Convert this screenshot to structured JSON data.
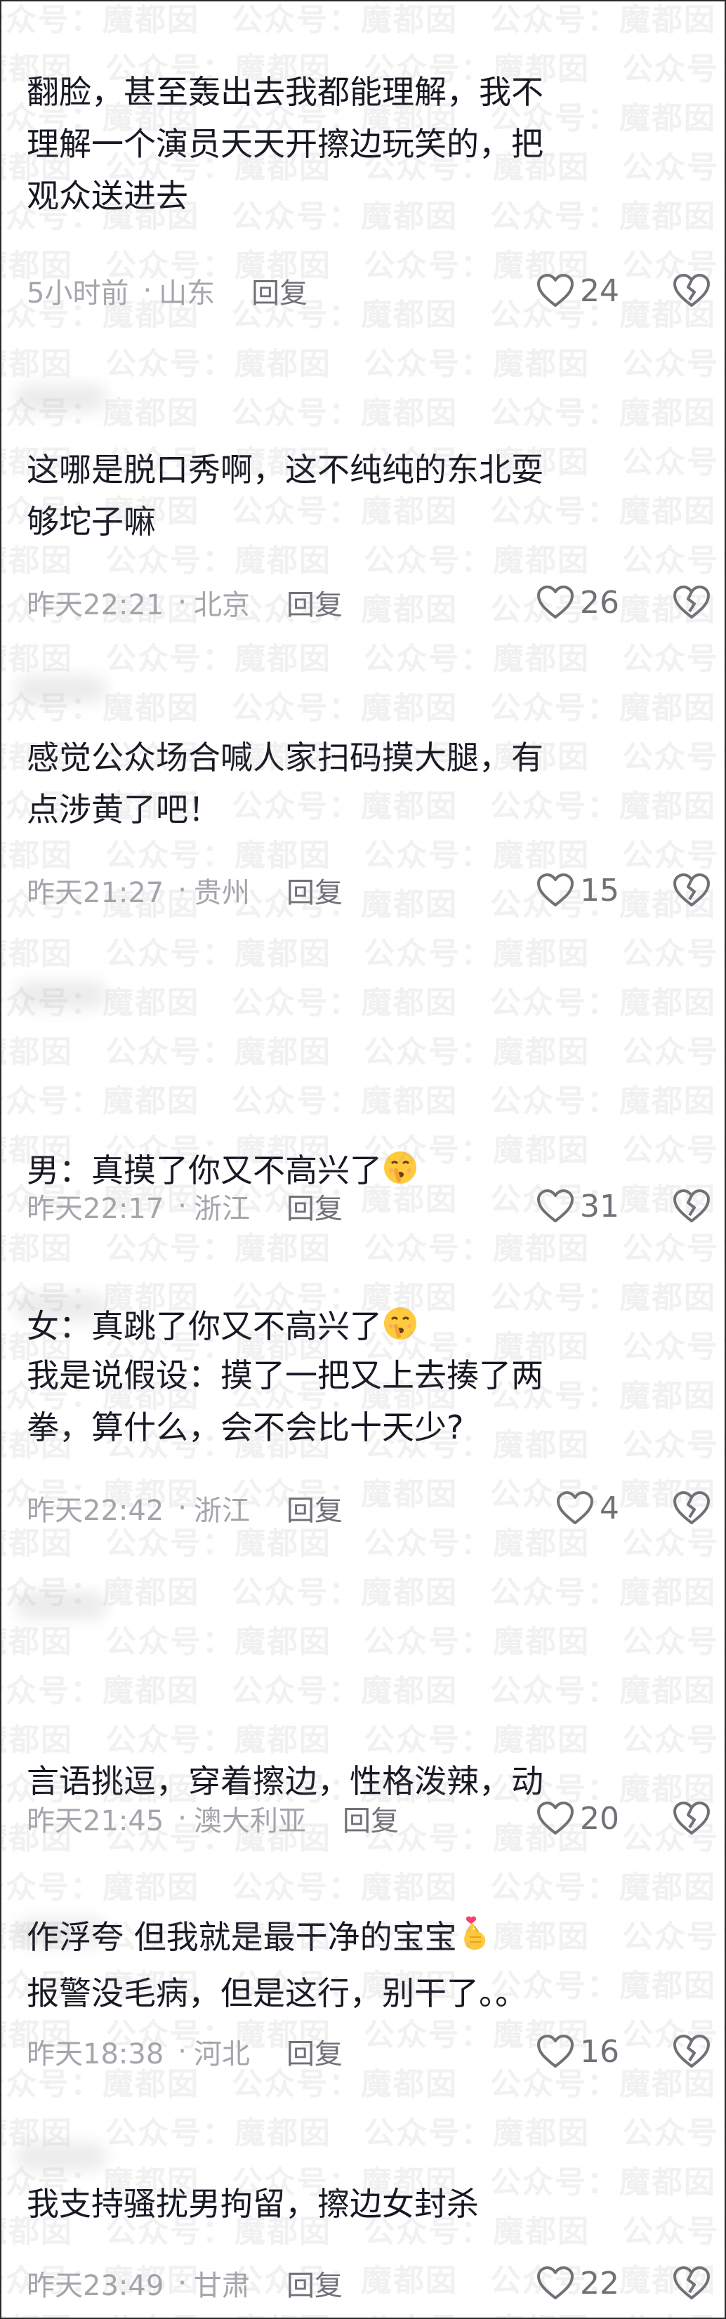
{
  "watermark": {
    "text": "公众号：魔都囡"
  },
  "comments": [
    {
      "text": "翻脸，甚至轰出去我都能理解，我不\n理解一个演员天天开擦边玩笑的，把\n观众送进去",
      "time": "5小时前",
      "location": "山东",
      "reply_label": "回复",
      "likes": "24"
    },
    {
      "text": "这哪是脱口秀啊，这不纯纯的东北耍\n够坨子嘛",
      "time": "昨天22:21",
      "location": "北京",
      "reply_label": "回复",
      "likes": "26"
    },
    {
      "text": "感觉公众场合喊人家扫码摸大腿，有\n点涉黄了吧！",
      "time": "昨天21:27",
      "location": "贵州",
      "reply_label": "回复",
      "likes": "15"
    },
    {
      "line1": "男：真摸了你又不高兴了",
      "line2": "女：真跳了你又不高兴了",
      "emoji": "shushing-face-emoji",
      "time": "昨天22:17",
      "location": "浙江",
      "reply_label": "回复",
      "likes": "31"
    },
    {
      "text": "我是说假设：摸了一把又上去揍了两\n拳，算什么，会不会比十天少?",
      "time": "昨天22:42",
      "location": "浙江",
      "reply_label": "回复",
      "likes": "4"
    },
    {
      "line1": "言语挑逗，穿着擦边，性格泼辣，动",
      "line2": "作浮夸 但我就是最干净的宝宝",
      "emoji": "finger-heart-emoji",
      "time": "昨天21:45",
      "location": "澳大利亚",
      "reply_label": "回复",
      "likes": "20"
    },
    {
      "text": "报警没毛病，但是这行，别干了。。",
      "time": "昨天18:38",
      "location": "河北",
      "reply_label": "回复",
      "likes": "16"
    },
    {
      "text": "我支持骚扰男拘留，擦边女封杀",
      "time": "昨天23:49",
      "location": "甘肃",
      "reply_label": "回复",
      "likes": "22"
    }
  ],
  "icons": {
    "like": "heart-outline-icon",
    "dislike": "broken-heart-icon"
  },
  "colors": {
    "text": "#161823",
    "meta": "#a4a6ac",
    "reply": "#6f7177"
  }
}
